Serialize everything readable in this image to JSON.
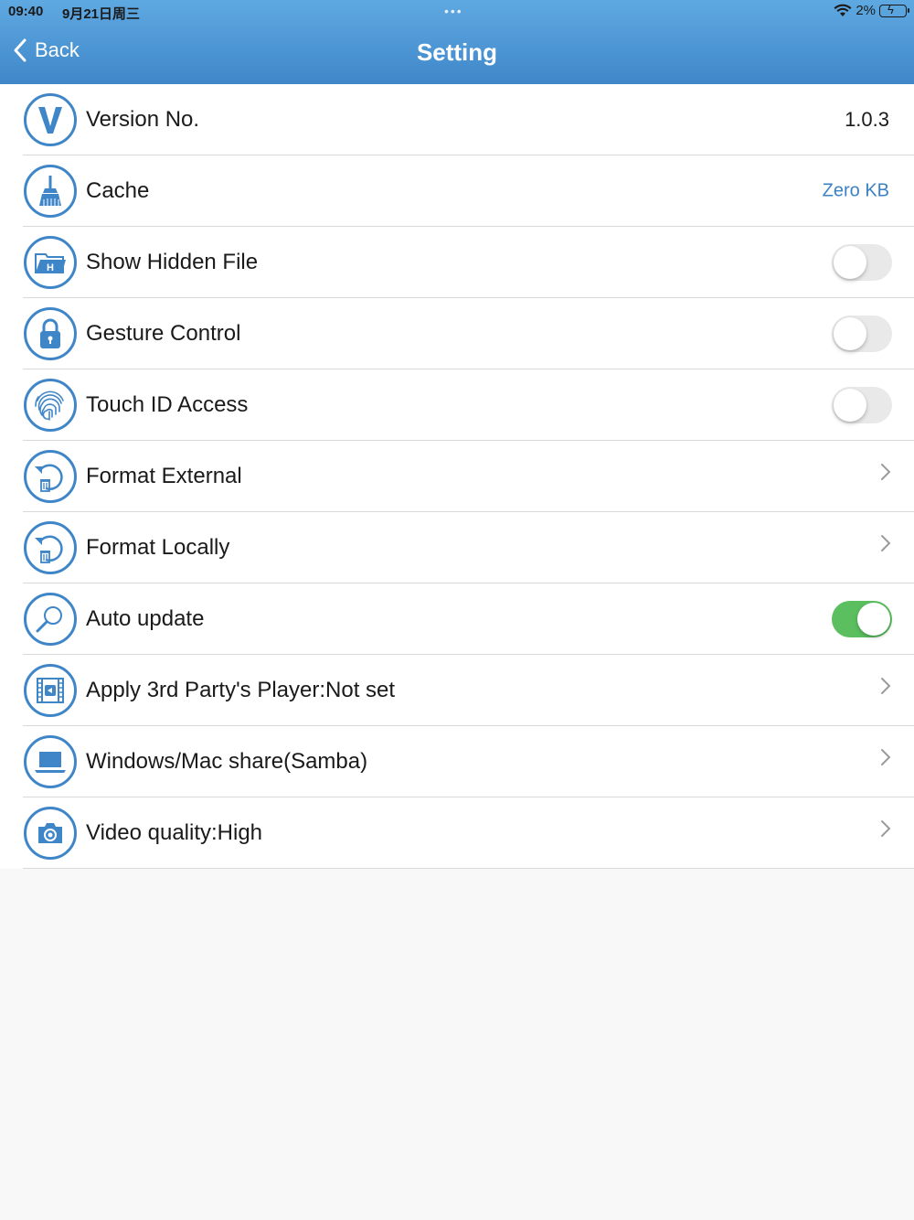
{
  "status_bar": {
    "time": "09:40",
    "date": "9月21日周三",
    "dots": "•••",
    "battery_percent": "2%"
  },
  "nav": {
    "back_label": "Back",
    "title": "Setting"
  },
  "rows": [
    {
      "label": "Version No.",
      "value": "1.0.3",
      "icon": "version-v-icon"
    },
    {
      "label": "Cache",
      "value": "Zero KB",
      "icon": "broom-icon"
    },
    {
      "label": "Show Hidden File",
      "toggle": false,
      "icon": "hidden-folder-icon"
    },
    {
      "label": "Gesture Control",
      "toggle": false,
      "icon": "lock-icon"
    },
    {
      "label": "Touch ID Access",
      "toggle": false,
      "icon": "fingerprint-icon"
    },
    {
      "label": "Format External",
      "chevron": true,
      "icon": "format-trash-icon"
    },
    {
      "label": "Format Locally",
      "chevron": true,
      "icon": "format-trash-icon"
    },
    {
      "label": "Auto update",
      "toggle": true,
      "icon": "search-update-icon"
    },
    {
      "label": "Apply 3rd Party's Player:Not set",
      "chevron": true,
      "icon": "film-player-icon"
    },
    {
      "label": "Windows/Mac share(Samba)",
      "chevron": true,
      "icon": "laptop-icon"
    },
    {
      "label": "Video quality:High",
      "chevron": true,
      "icon": "camera-icon"
    }
  ],
  "colors": {
    "header_top": "#5fa9e2",
    "header_bottom": "#3f87c9",
    "icon_blue": "#3f86c8",
    "link_blue": "#3b82c4",
    "toggle_on": "#5bbf5f",
    "toggle_off": "#e9e9ea"
  }
}
